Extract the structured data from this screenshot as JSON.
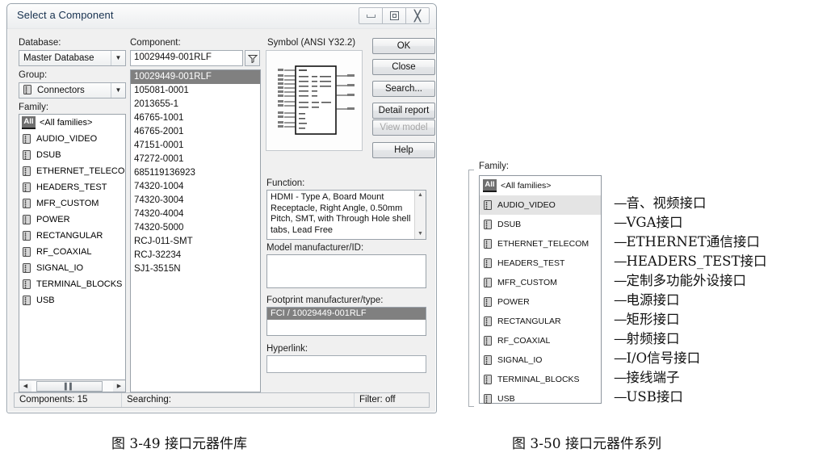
{
  "dialog": {
    "title": "Select a Component",
    "window_controls": {
      "minimize": "minimize-button",
      "restore": "restore-button",
      "close": "close-button"
    },
    "labels": {
      "database": "Database:",
      "group": "Group:",
      "family": "Family:",
      "component": "Component:",
      "symbol": "Symbol (ANSI Y32.2)",
      "function": "Function:",
      "model_manufacturer": "Model manufacturer/ID:",
      "footprint_manufacturer": "Footprint manufacturer/type:",
      "hyperlink": "Hyperlink:"
    },
    "database_value": "Master Database",
    "group_value": "Connectors",
    "component_value": "10029449-001RLF",
    "family_items": [
      {
        "label": "<All families>",
        "icon": "all-families-icon",
        "selected": false
      },
      {
        "label": "AUDIO_VIDEO",
        "icon": "connector-icon",
        "selected": true
      },
      {
        "label": "DSUB",
        "icon": "connector-icon",
        "selected": false
      },
      {
        "label": "ETHERNET_TELECOM",
        "icon": "connector-icon",
        "selected": false
      },
      {
        "label": "HEADERS_TEST",
        "icon": "connector-icon",
        "selected": false
      },
      {
        "label": "MFR_CUSTOM",
        "icon": "connector-icon",
        "selected": false
      },
      {
        "label": "POWER",
        "icon": "connector-icon",
        "selected": false
      },
      {
        "label": "RECTANGULAR",
        "icon": "connector-icon",
        "selected": false
      },
      {
        "label": "RF_COAXIAL",
        "icon": "connector-icon",
        "selected": false
      },
      {
        "label": "SIGNAL_IO",
        "icon": "connector-icon",
        "selected": false
      },
      {
        "label": "TERMINAL_BLOCKS",
        "icon": "connector-icon",
        "selected": false
      },
      {
        "label": "USB",
        "icon": "connector-icon",
        "selected": false
      }
    ],
    "component_items": [
      {
        "label": "10029449-001RLF",
        "selected": true
      },
      {
        "label": "105081-0001",
        "selected": false
      },
      {
        "label": "2013655-1",
        "selected": false
      },
      {
        "label": "46765-1001",
        "selected": false
      },
      {
        "label": "46765-2001",
        "selected": false
      },
      {
        "label": "47151-0001",
        "selected": false
      },
      {
        "label": "47272-0001",
        "selected": false
      },
      {
        "label": "685119136923",
        "selected": false
      },
      {
        "label": "74320-1004",
        "selected": false
      },
      {
        "label": "74320-3004",
        "selected": false
      },
      {
        "label": "74320-4004",
        "selected": false
      },
      {
        "label": "74320-5000",
        "selected": false
      },
      {
        "label": "RCJ-011-SMT",
        "selected": false
      },
      {
        "label": "RCJ-32234",
        "selected": false
      },
      {
        "label": "SJ1-3515N",
        "selected": false
      }
    ],
    "function_text": "HDMI - Type A, Board Mount Receptacle, Right Angle, 0.50mm Pitch, SMT, with Through Hole shell tabs, Lead Free",
    "model_manufacturer_value": "",
    "footprint_value": "FCI / 10029449-001RLF",
    "hyperlink_value": "",
    "buttons": [
      {
        "label": "OK",
        "name": "ok-button",
        "disabled": false
      },
      {
        "label": "Close",
        "name": "close-button",
        "disabled": false
      },
      {
        "label": "Search...",
        "name": "search-button",
        "disabled": false
      },
      {
        "label": "Detail report",
        "name": "detail-report-button",
        "disabled": false
      },
      {
        "label": "View model",
        "name": "view-model-button",
        "disabled": true
      },
      {
        "label": "Help",
        "name": "help-button",
        "disabled": false
      }
    ],
    "statusbar": {
      "components": "Components: 15",
      "searching": "Searching:",
      "filter": "Filter: off"
    }
  },
  "figure2": {
    "label_family": "Family:",
    "items": [
      {
        "label": "<All families>",
        "icon": "all-families-icon",
        "highlight": false,
        "annotation": ""
      },
      {
        "label": "AUDIO_VIDEO",
        "icon": "connector-icon",
        "highlight": true,
        "annotation": "音、视频接口"
      },
      {
        "label": "DSUB",
        "icon": "connector-icon",
        "highlight": false,
        "annotation": "VGA接口"
      },
      {
        "label": "ETHERNET_TELECOM",
        "icon": "connector-icon",
        "highlight": false,
        "annotation": "ETHERNET通信接口"
      },
      {
        "label": "HEADERS_TEST",
        "icon": "connector-icon",
        "highlight": false,
        "annotation": "HEADERS_TEST接口"
      },
      {
        "label": "MFR_CUSTOM",
        "icon": "connector-icon",
        "highlight": false,
        "annotation": "定制多功能外设接口"
      },
      {
        "label": "POWER",
        "icon": "connector-icon",
        "highlight": false,
        "annotation": "电源接口"
      },
      {
        "label": "RECTANGULAR",
        "icon": "connector-icon",
        "highlight": false,
        "annotation": "矩形接口"
      },
      {
        "label": "RF_COAXIAL",
        "icon": "connector-icon",
        "highlight": false,
        "annotation": "射频接口"
      },
      {
        "label": "SIGNAL_IO",
        "icon": "connector-icon",
        "highlight": false,
        "annotation": "I/O信号接口"
      },
      {
        "label": "TERMINAL_BLOCKS",
        "icon": "connector-icon",
        "highlight": false,
        "annotation": "接线端子"
      },
      {
        "label": "USB",
        "icon": "connector-icon",
        "highlight": false,
        "annotation": "USB接口"
      }
    ]
  },
  "captions": {
    "left": "图 3-49   接口元器件库",
    "right": "图 3-50   接口元器件系列"
  },
  "colors": {
    "selection": "#808080",
    "highlight": "#e4e4e4",
    "dialog_bg": "#f0f0f0",
    "title_text": "#17314f"
  }
}
